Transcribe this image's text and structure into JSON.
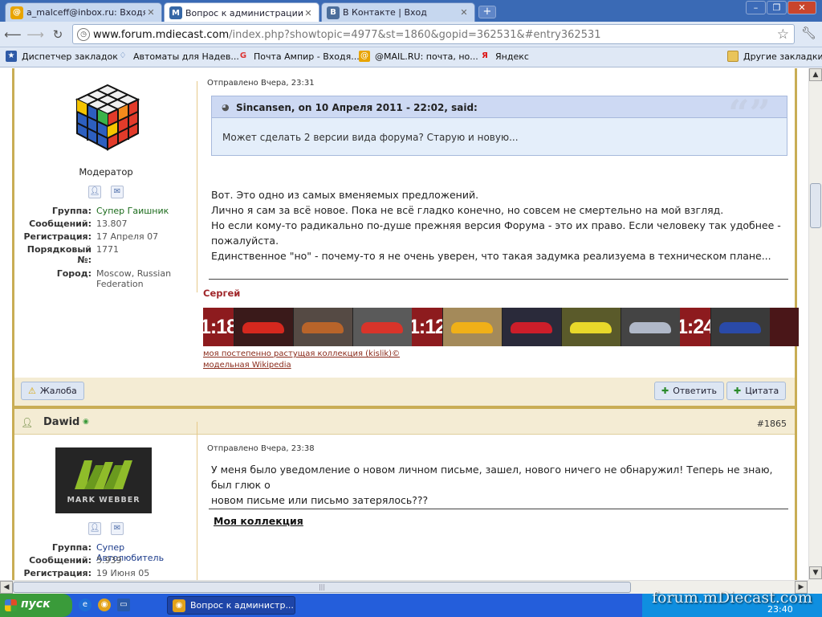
{
  "browser": {
    "tabs": [
      {
        "label": "a_malceff@inbox.ru: Входя...",
        "favicon": "@"
      },
      {
        "label": "Вопрос к администрации ...",
        "favicon": "M"
      },
      {
        "label": "В Контакте | Вход",
        "favicon": "B"
      }
    ],
    "new_tab_label": "+",
    "window_buttons": {
      "minimize": "–",
      "maximize": "❐",
      "close": "✕"
    },
    "url_host": "www.forum.mdiecast.com",
    "url_path": "/index.php?showtopic=4977&st=1860&gopid=362531&#entry362531",
    "bookmarks": [
      {
        "label": "Диспетчер закладок",
        "icon": "star-icon"
      },
      {
        "label": "Автоматы для Надев...",
        "icon": "tulip-icon"
      },
      {
        "label": "Почта Ампир - Входя...",
        "icon": "g-icon"
      },
      {
        "label": "@MAIL.RU: почта, но...",
        "icon": "at-icon"
      },
      {
        "label": "Яндекс",
        "icon": "yandex-icon"
      }
    ],
    "other_bookmarks": "Другие закладки"
  },
  "post1": {
    "role": "Модератор",
    "fields": [
      {
        "label": "Группа:",
        "value": "Супер Гаишник"
      },
      {
        "label": "Сообщений:",
        "value": "13.807"
      },
      {
        "label": "Регистрация:",
        "value": "17 Апреля 07"
      },
      {
        "label": "Порядковый №:",
        "value": "1771"
      },
      {
        "label": "Город:",
        "value": "Moscow, Russian Federation"
      }
    ],
    "posted": "Отправлено Вчера, 23:31",
    "quote_header": "Sincansen, on 10 Апреля 2011 - 22:02, said:",
    "quote_body": "Может сделать 2 версии вида форума? Старую и новую...",
    "lines": [
      "Вот. Это одно из самых вменяемых предложений.",
      "Лично я сам за всё новое. Пока не всё гладко конечно, но совсем не смертельно на мой взгляд.",
      "Но если кому-то радикально по-душе прежняя версия Форума - это их право. Если человеку так удобнее -",
      "пожалуйста.",
      "Единственное \"но\" - почему-то я не очень уверен, что такая задумка реализуема в техническом плане..."
    ],
    "signature_name": "Сергей",
    "banner_scales": [
      "1:18",
      "1:12",
      "1:24"
    ],
    "sig_link1": "моя постепенно растущая коллекция (kislik)©",
    "sig_link2": "модельная Wikipedia",
    "report_label": "Жалоба",
    "reply_label": "Ответить",
    "quote_label": "Цитата"
  },
  "post2": {
    "username": "Dawid",
    "post_number": "#1865",
    "avatar_text": "MARK WEBBER",
    "fields": [
      {
        "label": "Группа:",
        "value": "Супер Автолюбитель"
      },
      {
        "label": "Сообщений:",
        "value": "5.939"
      },
      {
        "label": "Регистрация:",
        "value": "19 Июня 05"
      }
    ],
    "posted": "Отправлено Вчера, 23:38",
    "lines": [
      "У меня было уведомление о новом личном письме, зашел, нового ничего не обнаружил! Теперь не знаю, был глюк о",
      "новом письме или письмо затерялось???"
    ],
    "collection_link": "Моя коллекция"
  },
  "taskbar": {
    "start": "пуск",
    "task": "Вопрос к администр...",
    "watermark": "forum.mDiecast.com",
    "clock": "23:40"
  }
}
